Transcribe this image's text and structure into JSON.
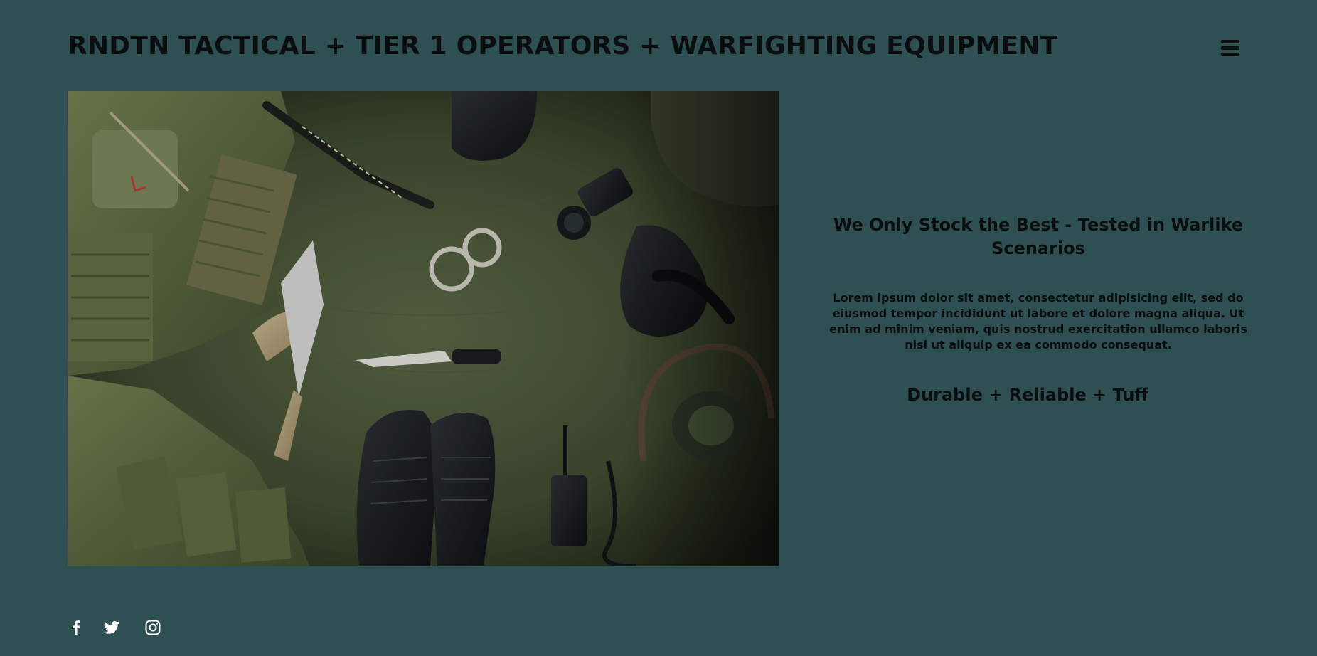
{
  "header": {
    "title": "RNDTN TACTICAL + TIER 1 OPERATORS + WARFIGHTING EQUIPMENT",
    "menu_icon": "hamburger-menu-icon"
  },
  "hero": {
    "image_subject": "tactical gear flat-lay"
  },
  "main": {
    "headline": "We Only Stock the Best - Tested in Warlike Scenarios",
    "body": "Lorem ipsum dolor sit amet, consectetur adipisicing elit, sed do eiusmod tempor incididunt ut labore et dolore magna aliqua. Ut enim ad minim veniam, quis nostrud exercitation ullamco laboris nisi ut aliquip ex ea commodo consequat.",
    "tagline": "Durable + Reliable + Tuff"
  },
  "social": {
    "icons": [
      "facebook-icon",
      "twitter-icon",
      "instagram-icon"
    ]
  },
  "colors": {
    "background": "#2f5052",
    "text": "#0a0e0f",
    "icon": "#ffffff"
  }
}
